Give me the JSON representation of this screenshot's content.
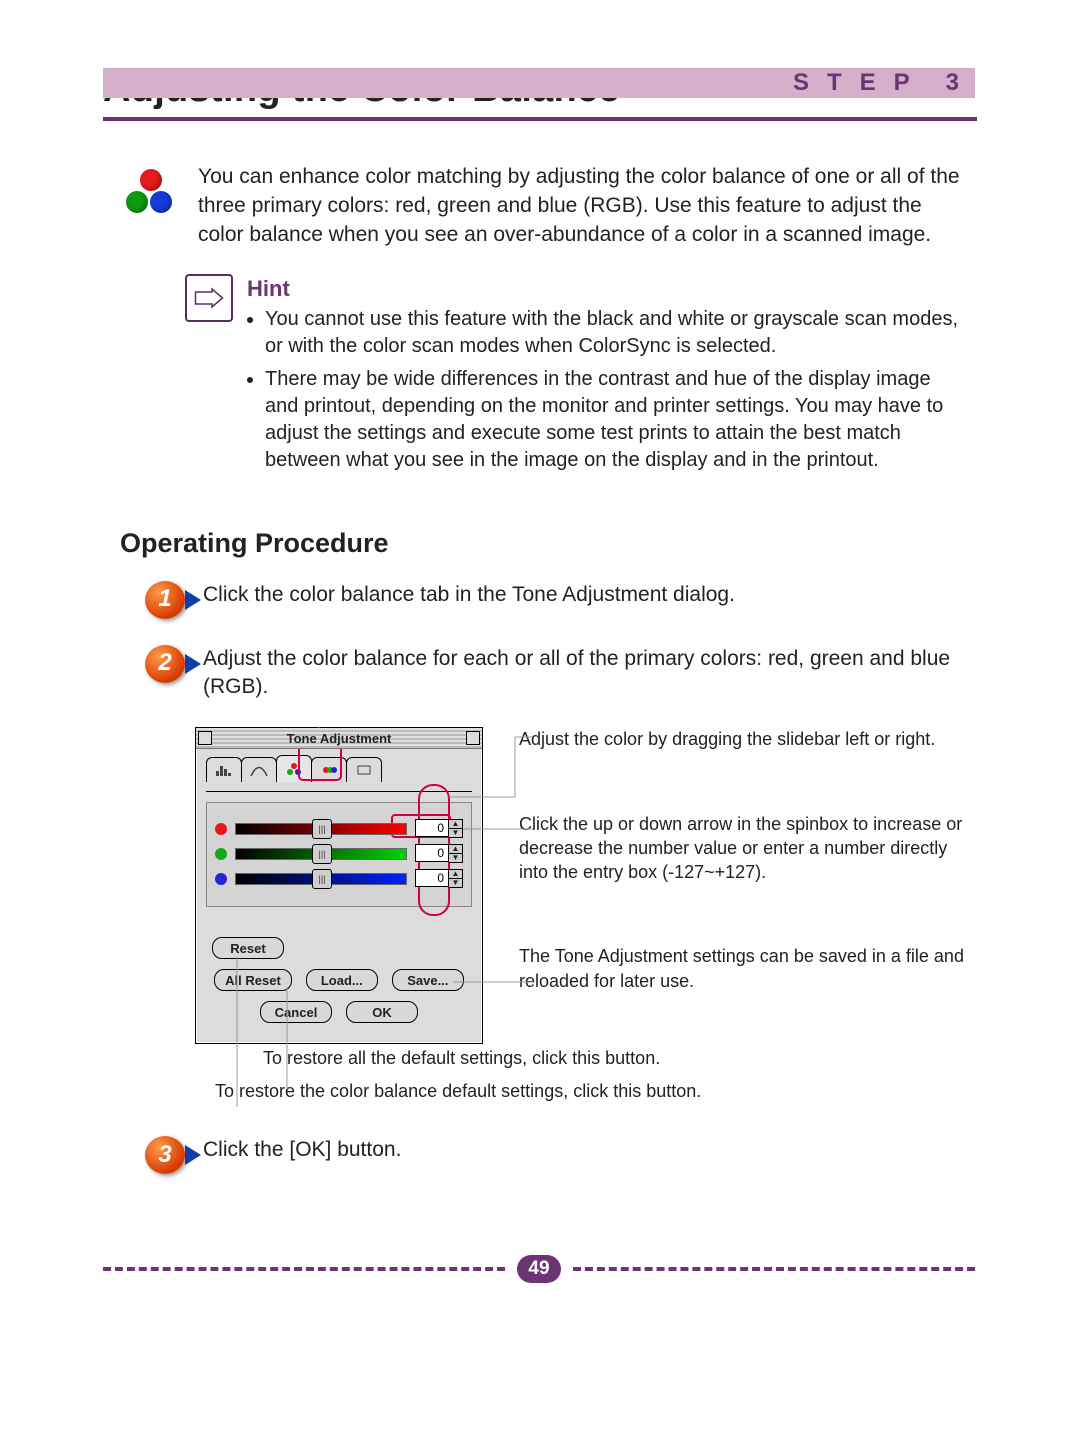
{
  "header": {
    "step_label": "STEP",
    "step_number": "3"
  },
  "title": "Adjusting the Color Balance",
  "intro": "You can enhance color matching by adjusting the color balance of one or all of the three primary colors: red, green and blue (RGB). Use this feature to adjust the color balance when you see an over-abundance of a color in a scanned image.",
  "hint": {
    "title": "Hint",
    "bullets": [
      "You cannot use this feature with the black and white or grayscale scan modes, or with the color scan modes when ColorSync is selected.",
      "There may be wide differences in the contrast and hue of the display image and printout, depending on the monitor and printer settings. You may have to adjust the settings and execute some test prints to attain the best match between what you see in the image on the display and in the printout."
    ]
  },
  "procedure": {
    "title": "Operating Procedure",
    "steps": [
      "Click the color balance tab in the Tone Adjustment dialog.",
      "Adjust the color balance for each or all of the primary colors: red, green and blue (RGB).",
      "Click the [OK] button."
    ]
  },
  "dialog": {
    "title": "Tone Adjustment",
    "tabs": [
      "histogram",
      "curve",
      "color-balance",
      "rgb-icon",
      "clear"
    ],
    "sliders": [
      {
        "color": "r",
        "value": "0"
      },
      {
        "color": "g",
        "value": "0"
      },
      {
        "color": "b",
        "value": "0"
      }
    ],
    "buttons": {
      "reset": "Reset",
      "all_reset": "All Reset",
      "load": "Load...",
      "save": "Save...",
      "cancel": "Cancel",
      "ok": "OK"
    }
  },
  "annotations": {
    "slider": "Adjust the color by dragging the slidebar left or right.",
    "spin": "Click the up or down arrow in the spinbox to increase or decrease the number value or enter a number directly into the entry box (-127~+127).",
    "loadsave": "The Tone Adjustment settings can be saved in a file and reloaded for later use.",
    "allreset": "To restore all the default settings, click this button.",
    "reset": "To restore the color balance default settings, click this button."
  },
  "page_number": "49"
}
